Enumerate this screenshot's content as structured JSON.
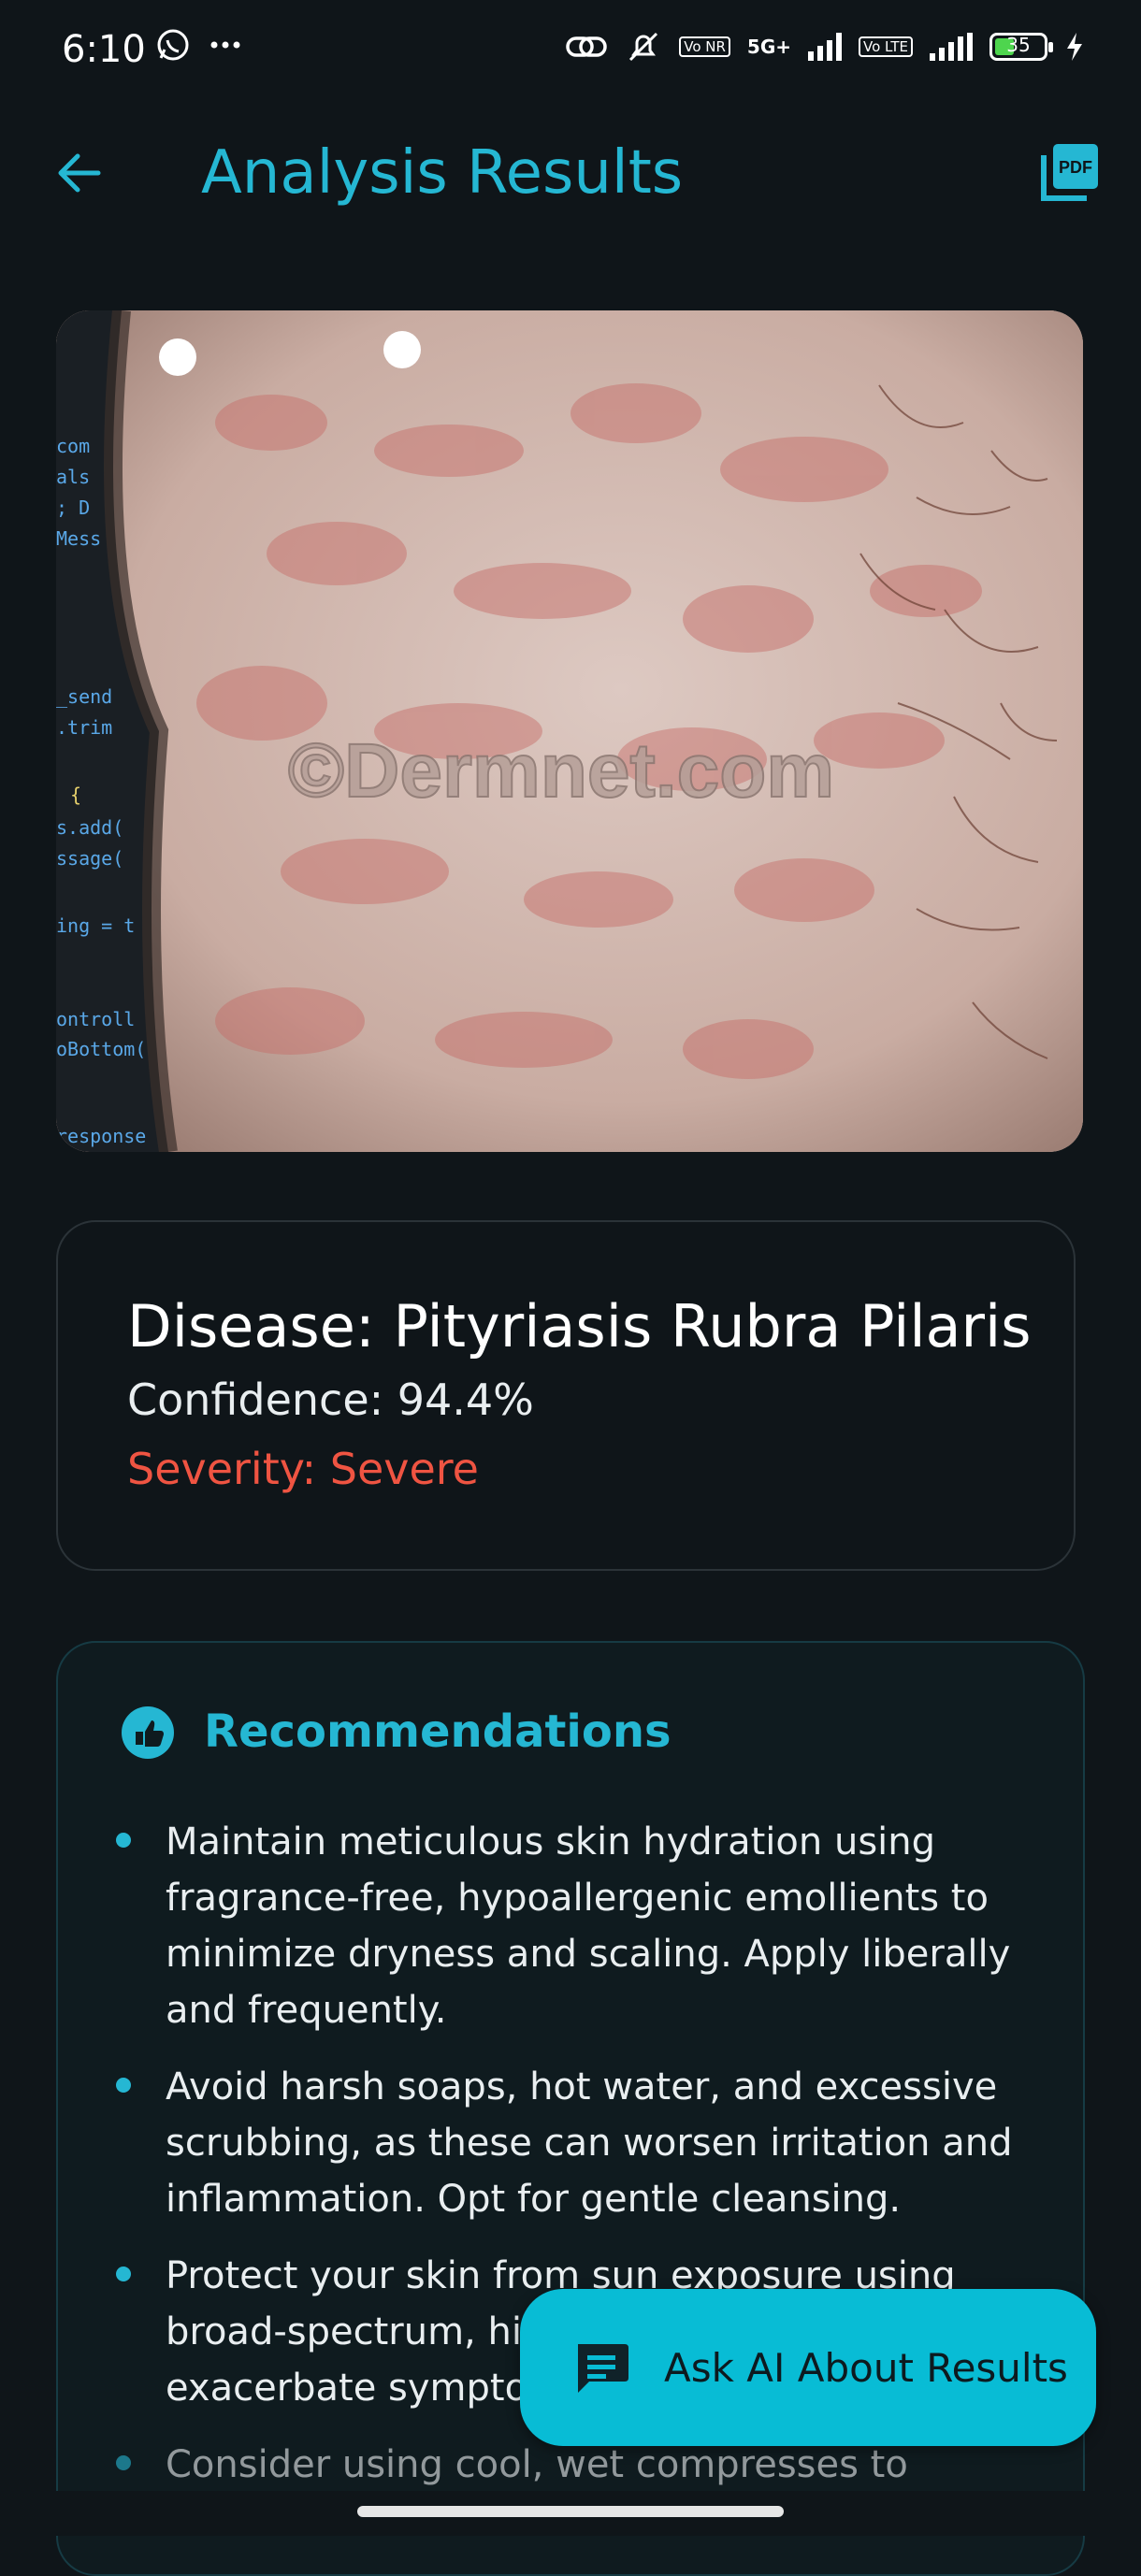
{
  "status_bar": {
    "time": "6:10",
    "battery": "35",
    "network_label": "5G+",
    "volte_1": "Vo NR",
    "volte_2": "Vo LTE",
    "icons": [
      "whatsapp-icon",
      "more-dots-icon",
      "link-icon",
      "mute-icon",
      "signal-icon",
      "battery-icon",
      "charging-icon"
    ]
  },
  "app_bar": {
    "title": "Analysis Results",
    "pdf_label": "PDF"
  },
  "image": {
    "watermark": "©Dermnet.com",
    "code_fragments": [
      "com",
      "als",
      "; D",
      "Mess",
      "_send",
      ".trim",
      "{",
      "s.add(",
      "ssage(",
      "ing = t",
      "ontroll",
      "oBottom(",
      "response"
    ]
  },
  "result": {
    "disease": "Disease: Pityriasis Rubra Pilaris",
    "confidence": "Confidence: 94.4%",
    "severity": "Severity: Severe"
  },
  "recommendations": {
    "title": "Recommendations",
    "items": [
      "Maintain meticulous skin hydration using fragrance-free, hypoallergenic emollients to minimize dryness and scaling. Apply liberally and frequently.",
      "Avoid harsh soaps, hot water, and excessive scrubbing, as these can worsen irritation and inflammation. Opt for gentle cleansing.",
      "Protect your skin from sun exposure using broad-spectrum, hi... even on cloudy day... exacerbate symptoms.",
      "Consider using cool, wet compresses to"
    ]
  },
  "fab": {
    "label": "Ask AI About Results"
  },
  "colors": {
    "accent": "#25b7d3",
    "severity": "#ef5442",
    "background": "#0f1519",
    "fab": "#08bcd5"
  }
}
